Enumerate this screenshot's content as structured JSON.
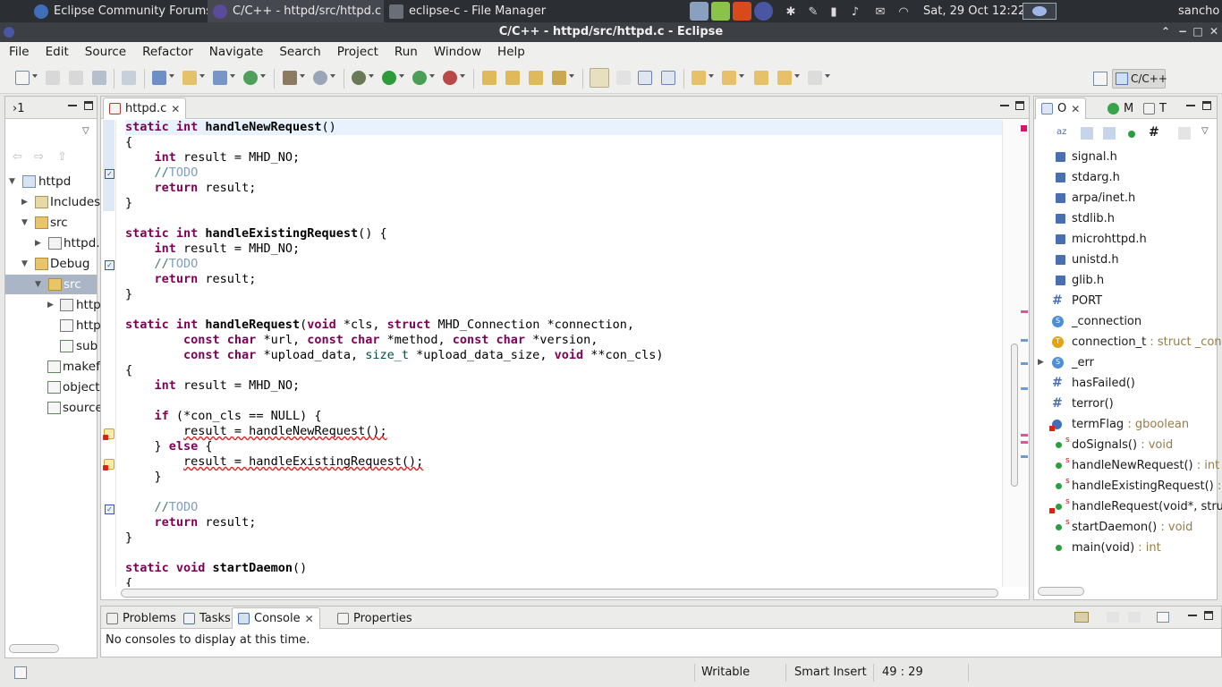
{
  "taskbar": {
    "tasks": [
      {
        "label": "Eclipse Community Forums...",
        "active": false
      },
      {
        "label": "C/C++ - httpd/src/httpd.c - ...",
        "active": true
      },
      {
        "label": "eclipse-c - File Manager",
        "active": false
      }
    ],
    "clock": "Sat, 29 Oct  12:22",
    "user": "sancho"
  },
  "window": {
    "title": "C/C++ - httpd/src/httpd.c - Eclipse"
  },
  "menu": [
    "File",
    "Edit",
    "Source",
    "Refactor",
    "Navigate",
    "Search",
    "Project",
    "Run",
    "Window",
    "Help"
  ],
  "perspective": {
    "label": "C/C++"
  },
  "explorer": {
    "tab_label": "›1",
    "tree": [
      {
        "label": "httpd",
        "depth": 0,
        "expanded": true
      },
      {
        "label": "Includes",
        "depth": 1,
        "expanded": false
      },
      {
        "label": "src",
        "depth": 1,
        "expanded": true
      },
      {
        "label": "httpd.",
        "depth": 2,
        "expanded": false
      },
      {
        "label": "Debug",
        "depth": 1,
        "expanded": true
      },
      {
        "label": "src",
        "depth": 2,
        "expanded": true,
        "selected": true
      },
      {
        "label": "http",
        "depth": 3,
        "expanded": false
      },
      {
        "label": "http",
        "depth": 3
      },
      {
        "label": "sub",
        "depth": 3
      },
      {
        "label": "makef",
        "depth": 2
      },
      {
        "label": "object",
        "depth": 2
      },
      {
        "label": "source",
        "depth": 2
      }
    ]
  },
  "editor": {
    "tab_label": "httpd.c",
    "code": [
      [
        {
          "t": "static int ",
          "c": "kw"
        },
        {
          "t": "handleNewRequest",
          "c": "fn"
        },
        {
          "t": "()"
        }
      ],
      [
        {
          "t": "{"
        }
      ],
      [
        {
          "t": "    "
        },
        {
          "t": "int",
          "c": "kw"
        },
        {
          "t": " result = MHD_NO;"
        }
      ],
      [
        {
          "t": "    //",
          "c": "cm"
        },
        {
          "t": "TODO",
          "c": "td"
        }
      ],
      [
        {
          "t": "    "
        },
        {
          "t": "return",
          "c": "kw"
        },
        {
          "t": " result;"
        }
      ],
      [
        {
          "t": "}"
        }
      ],
      [
        {
          "t": ""
        }
      ],
      [
        {
          "t": "static int ",
          "c": "kw"
        },
        {
          "t": "handleExistingRequest",
          "c": "fn"
        },
        {
          "t": "() {"
        }
      ],
      [
        {
          "t": "    "
        },
        {
          "t": "int",
          "c": "kw"
        },
        {
          "t": " result = MHD_NO;"
        }
      ],
      [
        {
          "t": "    //",
          "c": "cm"
        },
        {
          "t": "TODO",
          "c": "td"
        }
      ],
      [
        {
          "t": "    "
        },
        {
          "t": "return",
          "c": "kw"
        },
        {
          "t": " result;"
        }
      ],
      [
        {
          "t": "}"
        }
      ],
      [
        {
          "t": ""
        }
      ],
      [
        {
          "t": "static int ",
          "c": "kw"
        },
        {
          "t": "handleRequest",
          "c": "fn"
        },
        {
          "t": "("
        },
        {
          "t": "void",
          "c": "kw"
        },
        {
          "t": " *cls, "
        },
        {
          "t": "struct",
          "c": "kw"
        },
        {
          "t": " MHD_Connection *connection,"
        }
      ],
      [
        {
          "t": "        "
        },
        {
          "t": "const char",
          "c": "kw"
        },
        {
          "t": " *url, "
        },
        {
          "t": "const char",
          "c": "kw"
        },
        {
          "t": " *method, "
        },
        {
          "t": "const char",
          "c": "kw"
        },
        {
          "t": " *version,"
        }
      ],
      [
        {
          "t": "        "
        },
        {
          "t": "const char",
          "c": "kw"
        },
        {
          "t": " *upload_data, "
        },
        {
          "t": "size_t",
          "c": "ty"
        },
        {
          "t": " *upload_data_size, "
        },
        {
          "t": "void",
          "c": "kw"
        },
        {
          "t": " **con_cls)"
        }
      ],
      [
        {
          "t": "{"
        }
      ],
      [
        {
          "t": "    "
        },
        {
          "t": "int",
          "c": "kw"
        },
        {
          "t": " result = MHD_NO;"
        }
      ],
      [
        {
          "t": ""
        }
      ],
      [
        {
          "t": "    "
        },
        {
          "t": "if",
          "c": "kw"
        },
        {
          "t": " (*con_cls == NULL) {"
        }
      ],
      [
        {
          "t": "        "
        },
        {
          "t": "result = handleNewRequest();",
          "c": "sq"
        }
      ],
      [
        {
          "t": "    } "
        },
        {
          "t": "else",
          "c": "kw"
        },
        {
          "t": " {"
        }
      ],
      [
        {
          "t": "        "
        },
        {
          "t": "result = handleExistingRequest();",
          "c": "sq"
        }
      ],
      [
        {
          "t": "    }"
        }
      ],
      [
        {
          "t": ""
        }
      ],
      [
        {
          "t": "    //",
          "c": "cm"
        },
        {
          "t": "TODO",
          "c": "td"
        }
      ],
      [
        {
          "t": "    "
        },
        {
          "t": "return",
          "c": "kw"
        },
        {
          "t": " result;"
        }
      ],
      [
        {
          "t": "}"
        }
      ],
      [
        {
          "t": ""
        }
      ],
      [
        {
          "t": "static void ",
          "c": "kw"
        },
        {
          "t": "startDaemon",
          "c": "fn"
        },
        {
          "t": "()"
        }
      ],
      [
        {
          "t": "{"
        }
      ]
    ]
  },
  "outline": {
    "tab_labels": [
      "O",
      "M",
      "T"
    ],
    "items": [
      {
        "label": "signal.h",
        "icon": "include"
      },
      {
        "label": "stdarg.h",
        "icon": "include"
      },
      {
        "label": "arpa/inet.h",
        "icon": "include"
      },
      {
        "label": "stdlib.h",
        "icon": "include"
      },
      {
        "label": "microhttpd.h",
        "icon": "include"
      },
      {
        "label": "unistd.h",
        "icon": "include"
      },
      {
        "label": "glib.h",
        "icon": "include"
      },
      {
        "label": "PORT",
        "icon": "macro"
      },
      {
        "label": "_connection",
        "icon": "struct"
      },
      {
        "label": "connection_t",
        "type": " : struct _conn",
        "icon": "typedef"
      },
      {
        "label": "_err",
        "icon": "struct",
        "expandable": true
      },
      {
        "label": "hasFailed()",
        "icon": "macro"
      },
      {
        "label": "terror()",
        "icon": "macro"
      },
      {
        "label": "termFlag",
        "type": " : gboolean",
        "icon": "variable"
      },
      {
        "label": "doSignals()",
        "type": " : void",
        "icon": "function",
        "static": true
      },
      {
        "label": "handleNewRequest()",
        "type": " : int",
        "icon": "function",
        "static": true
      },
      {
        "label": "handleExistingRequest()",
        "type": " : in",
        "icon": "function",
        "static": true
      },
      {
        "label": "handleRequest(void*, struc",
        "icon": "function",
        "static": true,
        "error": true
      },
      {
        "label": "startDaemon()",
        "type": " : void",
        "icon": "function",
        "static": true
      },
      {
        "label": "main(void)",
        "type": " : int",
        "icon": "function"
      }
    ]
  },
  "console": {
    "tabs": [
      "Problems",
      "Tasks",
      "Console",
      "Properties"
    ],
    "message": "No consoles to display at this time."
  },
  "status": {
    "writable": "Writable",
    "insert_mode": "Smart Insert",
    "position": "49 : 29"
  }
}
